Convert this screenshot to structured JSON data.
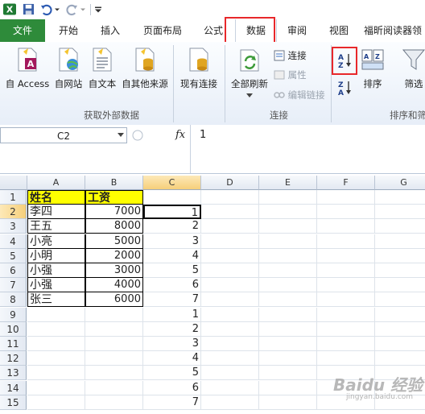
{
  "colors": {
    "accent_green": "#2e8b3a",
    "highlight": "#ffff00",
    "annotation_red": "#e8282b"
  },
  "ribbon_tabs": [
    "文件",
    "开始",
    "插入",
    "页面布局",
    "公式",
    "数据",
    "审阅",
    "视图",
    "福昕阅读器领"
  ],
  "ribbon": {
    "get_external": {
      "buttons": [
        "自 Access",
        "自网站",
        "自文本",
        "自其他来源",
        "现有连接"
      ],
      "group_label": "获取外部数据"
    },
    "connections": {
      "refresh_all": "全部刷新",
      "connect": "连接",
      "properties": "属性",
      "edit_links": "编辑链接",
      "group_label": "连接"
    },
    "sort_filter": {
      "sort": "排序",
      "filter": "筛选",
      "group_label": "排序和筛"
    }
  },
  "formula_bar": {
    "name_box": "C2",
    "fx": "fx",
    "content": "1"
  },
  "sheet": {
    "columns": [
      "A",
      "B",
      "C",
      "D",
      "E",
      "F",
      "G"
    ],
    "rows": [
      "1",
      "2",
      "3",
      "4",
      "5",
      "6",
      "7",
      "8",
      "9",
      "10",
      "11",
      "12",
      "13",
      "14",
      "15"
    ],
    "header_row": [
      "姓名",
      "工资"
    ],
    "names": [
      "李四",
      "王五",
      "小亮",
      "小明",
      "小强",
      "小强",
      "张三"
    ],
    "salaries": [
      "7000",
      "8000",
      "5000",
      "2000",
      "3000",
      "4000",
      "6000"
    ],
    "col_c": [
      "1",
      "2",
      "3",
      "4",
      "5",
      "6",
      "7",
      "1",
      "2",
      "3",
      "4",
      "5",
      "6",
      "7"
    ]
  },
  "watermark": "Baidu 经验",
  "watermark_sub": "jingyan.baidu.com"
}
